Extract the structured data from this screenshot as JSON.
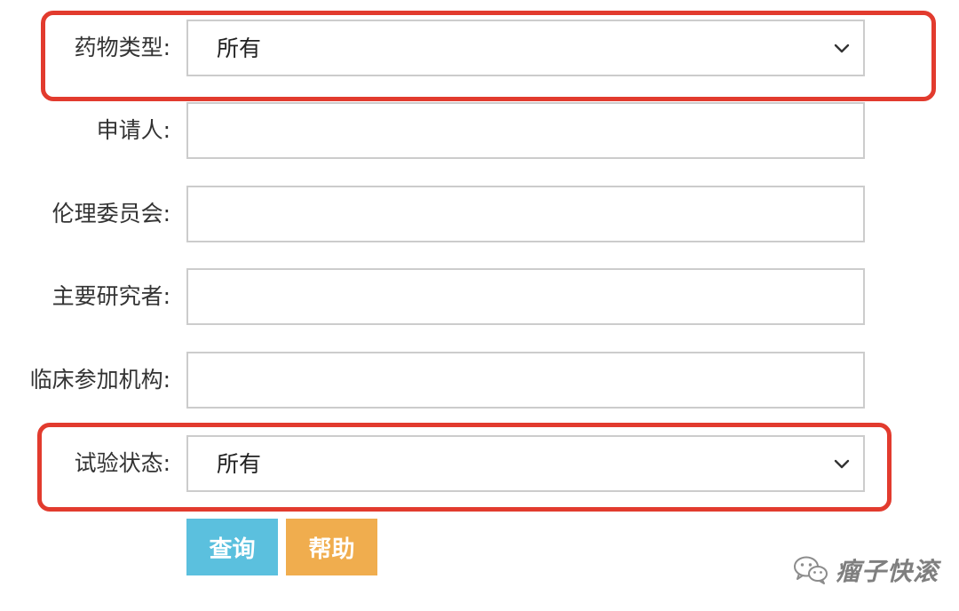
{
  "form": {
    "drug_type": {
      "label": "药物类型:",
      "value": "所有"
    },
    "applicant": {
      "label": "申请人:",
      "value": ""
    },
    "ethics_committee": {
      "label": "伦理委员会:",
      "value": ""
    },
    "principal_investigator": {
      "label": "主要研究者:",
      "value": ""
    },
    "clinical_institution": {
      "label": "临床参加机构:",
      "value": ""
    },
    "trial_status": {
      "label": "试验状态:",
      "value": "所有"
    }
  },
  "buttons": {
    "query": "查询",
    "help": "帮助"
  },
  "watermark": {
    "text": "瘤子快滚",
    "icon": "wechat-icon"
  },
  "colors": {
    "highlight": "#e23b2e",
    "query_button": "#5bc0de",
    "help_button": "#f0ad4e"
  }
}
